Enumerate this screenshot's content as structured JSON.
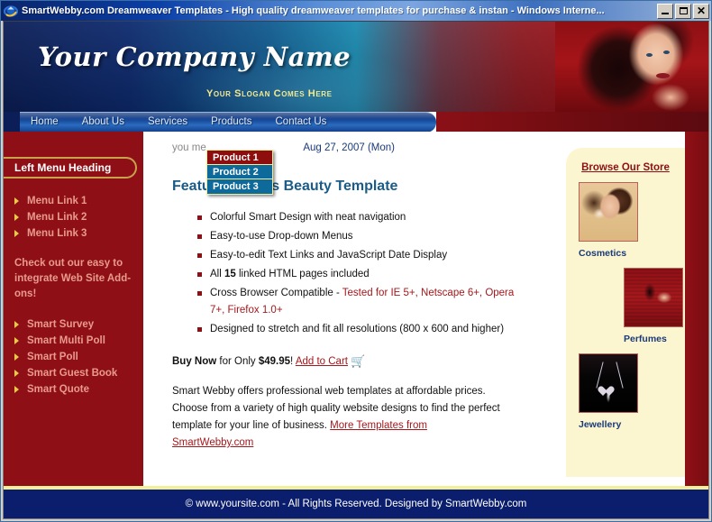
{
  "window": {
    "title": "SmartWebby.com Dreamweaver Templates - High quality dreamweaver templates for purchase & instan - Windows Interne...",
    "icon": "internet-explorer-icon",
    "minimize_label": "",
    "maximize_label": "",
    "close_label": "✕"
  },
  "banner": {
    "company_name": "Your Company Name",
    "slogan": "Your Slogan Comes Here"
  },
  "nav": {
    "items": [
      {
        "label": "Home"
      },
      {
        "label": "About Us"
      },
      {
        "label": "Services"
      },
      {
        "label": "Products"
      },
      {
        "label": "Contact Us"
      }
    ]
  },
  "dropdown": {
    "items": [
      {
        "label": "Product 1",
        "state": "active"
      },
      {
        "label": "Product 2",
        "state": "normal"
      },
      {
        "label": "Product 3",
        "state": "normal"
      }
    ]
  },
  "sidebar": {
    "heading": "Left Menu Heading",
    "links": [
      {
        "label": "Menu Link 1"
      },
      {
        "label": "Menu Link 2"
      },
      {
        "label": "Menu Link 3"
      }
    ],
    "note": "Check out our easy to integrate Web Site Add-ons!",
    "addons": [
      {
        "label": "Smart Survey"
      },
      {
        "label": "Smart Multi Poll"
      },
      {
        "label": "Smart Poll"
      },
      {
        "label": "Smart Guest Book"
      },
      {
        "label": "Smart Quote"
      }
    ]
  },
  "main": {
    "site_name_line": "you                              me",
    "date": "Aug 27, 2007 (Mon)",
    "features_title": "Features of this Beauty Template",
    "features": [
      {
        "text": "Colorful Smart Design with neat navigation"
      },
      {
        "text": "Easy-to-use Drop-down Menus"
      },
      {
        "text": "Easy-to-edit Text Links and JavaScript Date Display"
      },
      {
        "text": "All 15 linked HTML pages included",
        "bold_part": "15"
      },
      {
        "text": "Cross Browser Compatible - Tested for IE 5+, Netscape 6+, Opera 7+, Firefox 1.0+",
        "red_part": "Tested for IE 5+, Netscape 6+, Opera 7+, Firefox 1.0+"
      },
      {
        "text": "Designed to stretch and fit all resolutions (800 x 600 and higher)"
      }
    ],
    "buy": {
      "buy_now": "Buy Now",
      "for_only": " for Only ",
      "price": "$49.95",
      "excl": "! ",
      "add_to_cart": "Add to Cart",
      "cart_icon": "shopping-cart-icon"
    },
    "paragraph": {
      "text": "Smart Webby offers professional web templates at affordable prices. Choose from a variety of high quality website designs to find the perfect template for your line of business. ",
      "link": "More Templates from SmartWebby.com"
    }
  },
  "store": {
    "title": "Browse Our Store",
    "items": [
      {
        "caption": "Cosmetics"
      },
      {
        "caption": "Perfumes"
      },
      {
        "caption": "Jewellery"
      }
    ]
  },
  "footer": {
    "text": "© www.yoursite.com - All Rights Reserved. Designed by SmartWebby.com"
  },
  "colors": {
    "deep_red": "#8e1016",
    "navy": "#0b1e6e",
    "gold": "#f2ef9a",
    "cream": "#fbf6cf",
    "link_red": "#a4181c",
    "heading_blue": "#1a5b88"
  }
}
